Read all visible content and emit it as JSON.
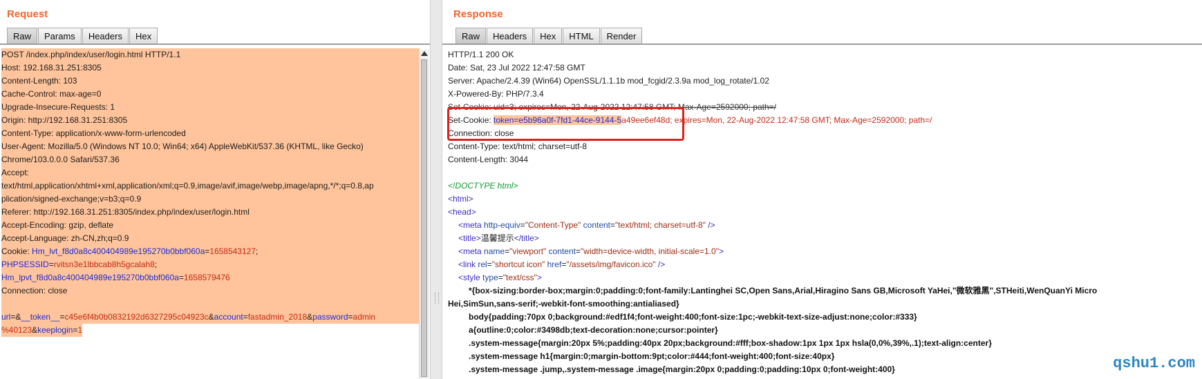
{
  "request": {
    "title": "Request",
    "tabs": [
      "Raw",
      "Params",
      "Headers",
      "Hex"
    ],
    "active_tab": "Raw",
    "lines": [
      "POST /index.php/index/user/login.html HTTP/1.1",
      "Host: 192.168.31.251:8305",
      "Content-Length: 103",
      "Cache-Control: max-age=0",
      "Upgrade-Insecure-Requests: 1",
      "Origin: http://192.168.31.251:8305",
      "Content-Type: application/x-www-form-urlencoded",
      "User-Agent: Mozilla/5.0 (Windows NT 10.0; Win64; x64) AppleWebKit/537.36 (KHTML, like Gecko)",
      "Chrome/103.0.0.0 Safari/537.36",
      "Accept:",
      "text/html,application/xhtml+xml,application/xml;q=0.9,image/avif,image/webp,image/apng,*/*;q=0.8,ap",
      "plication/signed-exchange;v=b3;q=0.9",
      "Referer: http://192.168.31.251:8305/index.php/index/user/login.html",
      "Accept-Encoding: gzip, deflate",
      "Accept-Language: zh-CN,zh;q=0.9"
    ],
    "cookie": {
      "label": "Cookie: ",
      "k1": "Hm_lvt_f8d0a8c400404989e195270b0bbf060a",
      "v1": "1658543127",
      "k2": "PHPSESSID",
      "v2": "rvitsn3e1lbbcab8h5gcalah8",
      "k3": "Hm_lpvt_f8d0a8c400404989e195270b0bbf060a",
      "v3": "1658579476"
    },
    "connection": "Connection: close",
    "body": {
      "k1": "url",
      "v1": "",
      "k2": "__token__",
      "v2": "c45e6f4b0b0832192d6327295c04923c",
      "k3": "account",
      "v3": "fastadmin_2018",
      "k4": "password",
      "v4a": "admin",
      "v4b": "%40123",
      "k5": "keeplogin",
      "v5": "1"
    }
  },
  "response": {
    "title": "Response",
    "tabs": [
      "Raw",
      "Headers",
      "Hex",
      "HTML",
      "Render"
    ],
    "active_tab": "Raw",
    "headers": [
      "HTTP/1.1 200 OK",
      "Date: Sat, 23 Jul 2022 12:47:58 GMT",
      "Server: Apache/2.4.39 (Win64) OpenSSL/1.1.1b mod_fcgid/2.3.9a mod_log_rotate/1.02",
      "X-Powered-By: PHP/7.3.4"
    ],
    "setcookie_uid": "Set-Cookie: uid=3; expires=Mon, 22-Aug-2022 12:47:58 GMT; Max-Age=2592000; path=/",
    "setcookie_token_prefix": "Set-Cookie: ",
    "setcookie_token_hl": "token=e5b96a0f-7fd1-44ce-9144-5",
    "setcookie_token_rest": "a49ee6ef48d; expires=Mon, 22-Aug-2022 12:47:58 GMT; Max-Age=2592000; path=/",
    "connection": "Connection: close",
    "headers2": [
      "Content-Type: text/html; charset=utf-8",
      "Content-Length: 3044"
    ],
    "doctype": "<!DOCTYPE html>",
    "html_open": "<html>",
    "head_open": "<head>",
    "meta1": {
      "tag_open": "<meta ",
      "a1": "http-equiv",
      "v1": "\"Content-Type\"",
      "a2": "content",
      "v2": "\"text/html; charset=utf-8\"",
      "close": " />"
    },
    "title_line": {
      "open": "<title>",
      "text": "温馨提示",
      "close": "</title>"
    },
    "meta2": {
      "tag_open": "<meta ",
      "a1": "name",
      "v1": "\"viewport\"",
      "a2": "content",
      "v2": "\"width=device-width, initial-scale=1.0\"",
      "close": ">"
    },
    "link": {
      "tag_open": "<link ",
      "a1": "rel",
      "v1": "\"shortcut icon\"",
      "a2": "href",
      "v2": "\"/assets/img/favicon.ico\"",
      "close": " />"
    },
    "style_open": {
      "tag_open": "<style ",
      "a1": "type",
      "v1": "\"text/css\"",
      "close": ">"
    },
    "css_lines": [
      "*{box-sizing:border-box;margin:0;padding:0;font-family:Lantinghei SC,Open Sans,Arial,Hiragino Sans GB,Microsoft YaHei,\"微软雅黑\",STHeiti,WenQuanYi Micro",
      "Hei,SimSun,sans-serif;-webkit-font-smoothing:antialiased}",
      "body{padding:70px 0;background:#edf1f4;font-weight:400;font-size:1pc;-webkit-text-size-adjust:none;color:#333}",
      "a{outline:0;color:#3498db;text-decoration:none;cursor:pointer}",
      ".system-message{margin:20px 5%;padding:40px 20px;background:#fff;box-shadow:1px 1px 1px hsla(0,0%,39%,.1);text-align:center}",
      ".system-message h1{margin:0;margin-bottom:9pt;color:#444;font-weight:400;font-size:40px}",
      ".system-message .jump,.system-message .image{margin:20px 0;padding:0;padding:10px 0;font-weight:400}"
    ]
  },
  "watermark": "qshu1.com"
}
